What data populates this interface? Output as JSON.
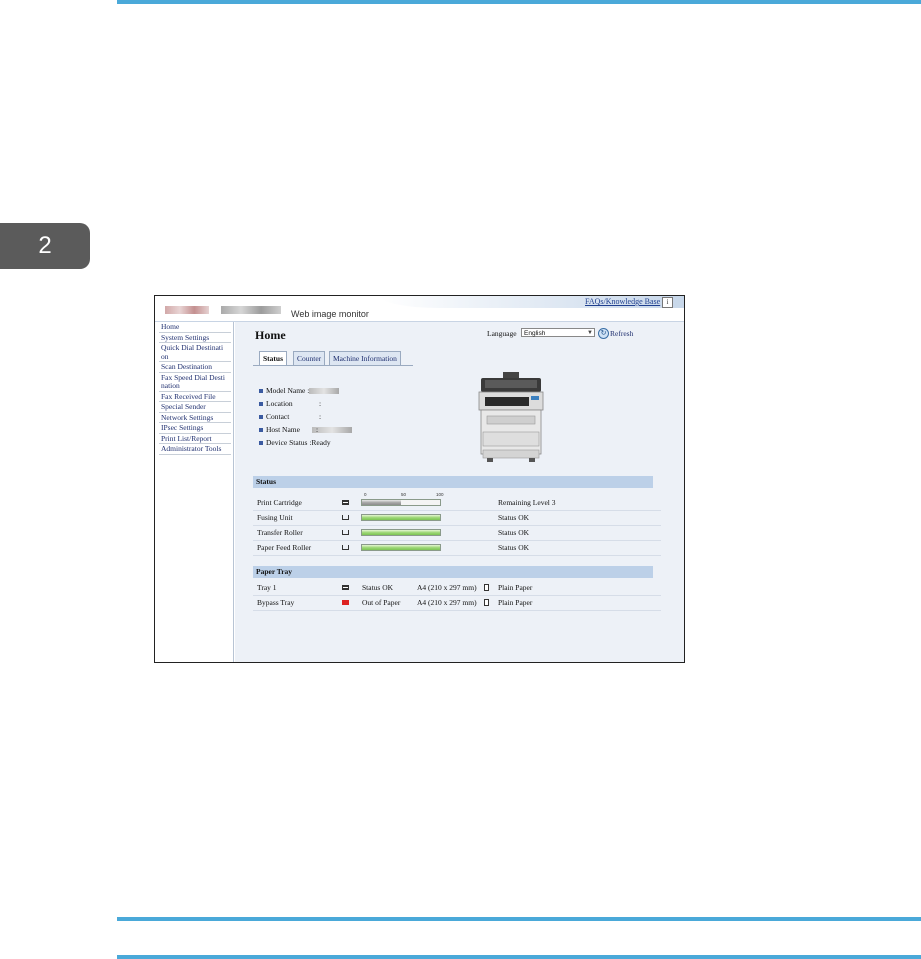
{
  "doc": {
    "chapter": "2"
  },
  "header": {
    "title": "Web image monitor",
    "faq_link": "FAQs/Knowledge Base",
    "info_icon": "i"
  },
  "sidebar": {
    "items": [
      {
        "label": "Home"
      },
      {
        "label": "System Settings"
      },
      {
        "label": "Quick Dial Destinati on"
      },
      {
        "label": "Scan Destination"
      },
      {
        "label": "Fax Speed Dial Desti nation"
      },
      {
        "label": "Fax Received File"
      },
      {
        "label": "Special Sender"
      },
      {
        "label": "Network Settings"
      },
      {
        "label": "IPsec Settings"
      },
      {
        "label": "Print List/Report"
      },
      {
        "label": "Administrator Tools"
      }
    ]
  },
  "main": {
    "title": "Home",
    "language_label": "Language",
    "language_value": "English",
    "refresh_label": "Refresh",
    "tabs": [
      {
        "label": "Status"
      },
      {
        "label": "Counter"
      },
      {
        "label": "Machine Information"
      }
    ],
    "device_info": [
      {
        "label": "Model Name",
        "value": ""
      },
      {
        "label": "Location",
        "value": ""
      },
      {
        "label": "Contact",
        "value": ""
      },
      {
        "label": "Host Name",
        "value": ""
      },
      {
        "label": "Device Status",
        "value": "Ready"
      }
    ],
    "status_section": {
      "title": "Status",
      "scale": [
        "0",
        "50",
        "100"
      ],
      "rows": [
        {
          "label": "Print Cartridge",
          "level_percent": 50,
          "bar_color": "grey",
          "status": "Remaining Level 3"
        },
        {
          "label": "Fusing Unit",
          "level_percent": 100,
          "bar_color": "green",
          "status": "Status OK"
        },
        {
          "label": "Transfer Roller",
          "level_percent": 100,
          "bar_color": "green",
          "status": "Status OK"
        },
        {
          "label": "Paper Feed Roller",
          "level_percent": 100,
          "bar_color": "green",
          "status": "Status OK"
        }
      ]
    },
    "paper_tray_section": {
      "title": "Paper Tray",
      "rows": [
        {
          "label": "Tray 1",
          "status": "Status OK",
          "size": "A4 (210 x 297 mm)",
          "type": "Plain Paper",
          "icon": "tray-icon"
        },
        {
          "label": "Bypass Tray",
          "status": "Out of Paper",
          "size": "A4 (210 x 297 mm)",
          "type": "Plain Paper",
          "icon": "out-of-paper-icon"
        }
      ]
    }
  },
  "colors": {
    "accent_rule": "#4aa9d9",
    "section_bar": "#bcd0e8",
    "ok_bar": "#9fd878",
    "error_icon": "#dd2222"
  }
}
